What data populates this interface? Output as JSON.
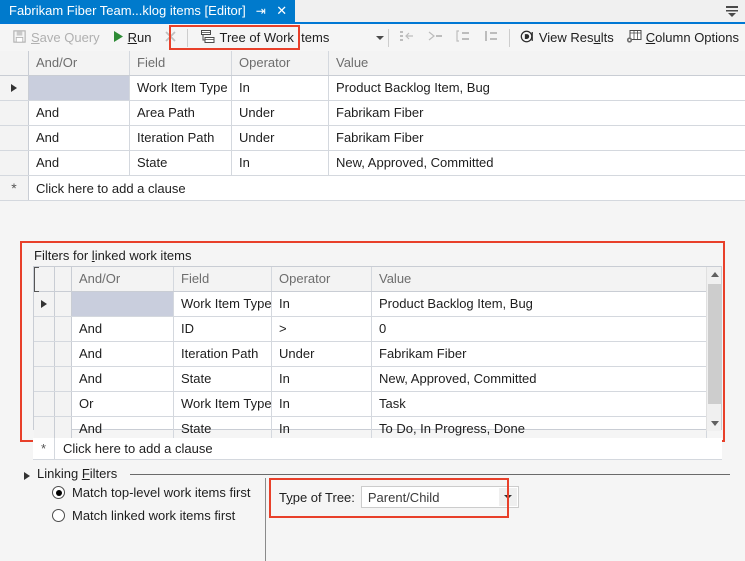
{
  "window": {
    "tab_title": "Fabrikam Fiber Team...klog items [Editor]",
    "pin_icon": "pin-icon",
    "close_icon": "close-icon",
    "overflow_icon": "tab-overflow-icon"
  },
  "toolbar": {
    "save_query": "Save Query",
    "save_icon": "save-icon",
    "run": "Run",
    "run_icon": "play-icon",
    "stop_icon": "stop-icon",
    "query_type": "Tree of Work Items",
    "query_type_icon": "tree-of-work-items-icon",
    "dropdown_icon": "chevron-down-icon",
    "indent_icon": "indent-icon",
    "outdent_icon": "outdent-icon",
    "group_icon": "group-clause-icon",
    "ungroup_icon": "ungroup-clause-icon",
    "view_results": "View Results",
    "view_results_icon": "view-results-icon",
    "column_options": "Column Options",
    "column_options_icon": "column-options-icon"
  },
  "top_grid": {
    "headers": [
      "And/Or",
      "Field",
      "Operator",
      "Value"
    ],
    "rows": [
      {
        "selected": true,
        "andor": "",
        "field": "Work Item Type",
        "operator": "In",
        "value": "Product Backlog Item, Bug"
      },
      {
        "selected": false,
        "andor": "And",
        "field": "Area Path",
        "operator": "Under",
        "value": "Fabrikam Fiber"
      },
      {
        "selected": false,
        "andor": "And",
        "field": "Iteration Path",
        "operator": "Under",
        "value": "Fabrikam Fiber"
      },
      {
        "selected": false,
        "andor": "And",
        "field": "State",
        "operator": "In",
        "value": "New, Approved, Committed"
      }
    ],
    "add_clause": "Click here to add a clause",
    "new_row_marker": "*"
  },
  "linked_panel": {
    "label": "Filters for linked work items",
    "headers": [
      "And/Or",
      "Field",
      "Operator",
      "Value"
    ],
    "rows": [
      {
        "selected": true,
        "andor": "",
        "field": "Work Item Type",
        "operator": "In",
        "value": "Product Backlog Item, Bug",
        "group": "start"
      },
      {
        "selected": false,
        "andor": "And",
        "field": "ID",
        "operator": ">",
        "value": "0",
        "group": "mid"
      },
      {
        "selected": false,
        "andor": "And",
        "field": "Iteration Path",
        "operator": "Under",
        "value": "Fabrikam Fiber",
        "group": "mid"
      },
      {
        "selected": false,
        "andor": "And",
        "field": "State",
        "operator": "In",
        "value": "New, Approved, Committed",
        "group": "end"
      },
      {
        "selected": false,
        "andor": "Or",
        "field": "Work Item Type",
        "operator": "In",
        "value": "Task",
        "group": "start"
      },
      {
        "selected": false,
        "andor": "And",
        "field": "State",
        "operator": "In",
        "value": "To Do, In Progress, Done",
        "group": "end"
      }
    ],
    "add_clause": "Click here to add a clause",
    "new_row_marker": "*",
    "scroll_up_icon": "scroll-up-arrow",
    "scroll_down_icon": "scroll-down-arrow"
  },
  "linking_filters": {
    "title": "Linking Filters",
    "expander_icon": "expander-triangle-icon",
    "options": [
      {
        "label": "Match top-level work items first",
        "selected": true
      },
      {
        "label": "Match linked work items first",
        "selected": false
      }
    ],
    "type_of_tree_label": "Type of Tree:",
    "type_of_tree_value": "Parent/Child",
    "type_of_tree_dropdown_icon": "chevron-down-icon"
  },
  "highlights": {
    "color": "#e8402a",
    "boxes": [
      "query-type-combo",
      "linked-filters-panel",
      "type-of-tree-combo"
    ]
  },
  "colors": {
    "title_bar": "#007acc",
    "accent_rule": "#0078d4",
    "highlight": "#e8402a",
    "selection": "#c9cedd"
  }
}
